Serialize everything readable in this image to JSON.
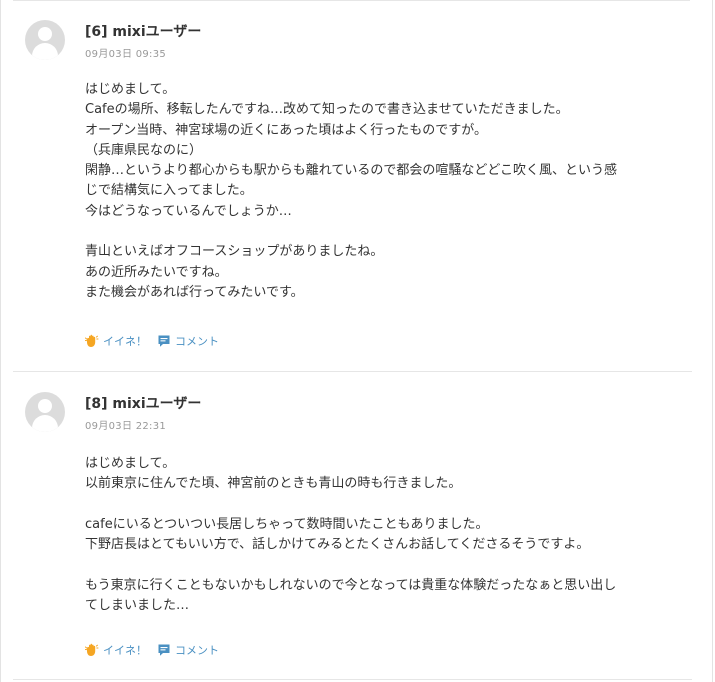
{
  "comments": [
    {
      "number_name": "[6] mixiユーザー",
      "timestamp": "09月03日 09:35",
      "lines": [
        "はじめまして。",
        "Cafeの場所、移転したんですね…改めて知ったので書き込ませていただきました。",
        "オープン当時、神宮球場の近くにあった頃はよく行ったものですが。",
        "（兵庫県民なのに）",
        "閑静…というより都心からも駅からも離れているので都会の喧騒などどこ吹く風、という感",
        "じで結構気に入ってました。",
        "今はどうなっているんでしょうか…",
        "",
        "青山といえばオフコースショップがありましたね。",
        "あの近所みたいですね。",
        "また機会があれば行ってみたいです。"
      ],
      "like_label": "イイネ！",
      "comment_label": "コメント"
    },
    {
      "number_name": "[8] mixiユーザー",
      "timestamp": "09月03日 22:31",
      "lines": [
        "はじめまして。",
        "以前東京に住んでた頃、神宮前のときも青山の時も行きました。",
        "",
        "cafeにいるとついつい長居しちゃって数時間いたこともありました。",
        "下野店長はとてもいい方で、話しかけてみるとたくさんお話してくださるそうですよ。",
        "",
        "もう東京に行くこともないかもしれないので今となっては貴重な体験だったなぁと思い出し",
        "てしまいました…"
      ],
      "like_label": "イイネ！",
      "comment_label": "コメント"
    }
  ],
  "icons": {
    "avatar": "user-silhouette-icon",
    "like": "like-hand-icon",
    "comment": "speech-bubble-icon"
  },
  "colors": {
    "like_icon": "#f5a623",
    "action_text": "#4a90c2",
    "comment_icon": "#4a90c2",
    "timestamp": "#999999",
    "avatar_bg": "#dcdcdc"
  }
}
